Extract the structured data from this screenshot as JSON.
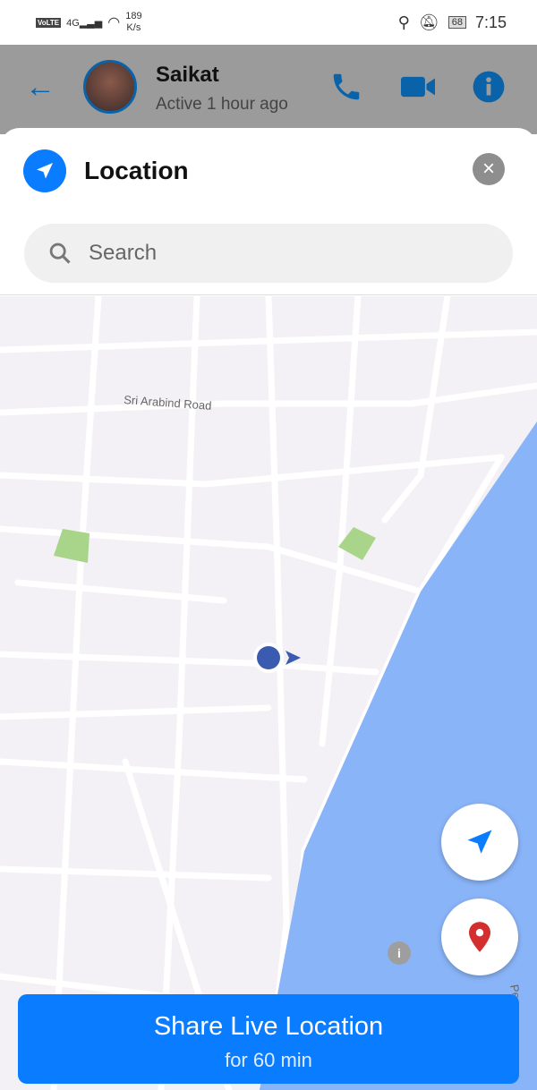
{
  "status_bar": {
    "network": "VoLTE",
    "signal": "4G",
    "speed_value": "189",
    "speed_unit": "K/s",
    "battery": "68",
    "time": "7:15"
  },
  "header": {
    "contact_name": "Saikat",
    "presence": "Active 1 hour ago"
  },
  "sheet": {
    "title": "Location",
    "search_placeholder": "Search"
  },
  "map": {
    "road_label": "Sri Arabind Road",
    "edge_label": "Pe",
    "water_color": "#8ab4f8"
  },
  "share": {
    "label": "Share Live Location",
    "duration": "for 60 min"
  },
  "colors": {
    "accent": "#0a7cff",
    "header_icons": "#0a63a8",
    "pin": "#d32f2f"
  }
}
